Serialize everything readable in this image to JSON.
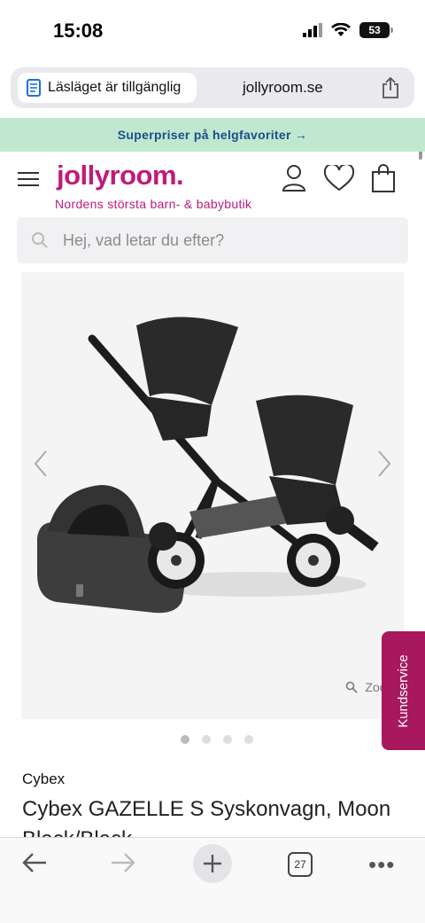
{
  "status": {
    "time": "15:08",
    "battery": "53"
  },
  "browser": {
    "reader_text": "Läsläget är tillgänglig",
    "url": "jollyroom.se",
    "tab_count": "27"
  },
  "promo": {
    "text": "Superpriser på helgfavoriter →"
  },
  "header": {
    "logo": "jollyroom.",
    "tagline": "Nordens största barn- & babybutik"
  },
  "search": {
    "placeholder": "Hej, vad letar du efter?"
  },
  "gallery": {
    "zoom_label": "Zooma",
    "dot_count": 4,
    "active_dot": 0
  },
  "support": {
    "label": "Kundservice"
  },
  "product": {
    "brand": "Cybex",
    "title": "Cybex GAZELLE S Syskonvagn, Moon Black/Black"
  },
  "colors": {
    "brand": "#c01b7a",
    "promo_bg": "#bfe8cf",
    "support_bg": "#a8185f"
  }
}
